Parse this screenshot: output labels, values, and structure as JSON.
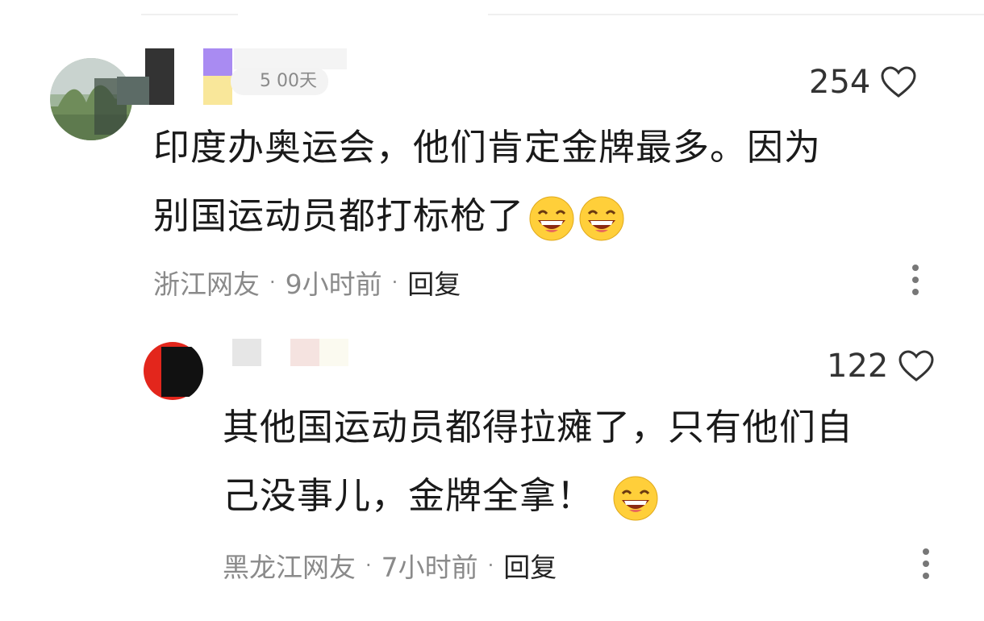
{
  "comments": [
    {
      "badge": "5 00天",
      "likes": "254",
      "text_line1": "印度办奥运会，他们肯定金牌最多。因为",
      "text_line2": "别国运动员都打标枪了",
      "location": "浙江网友",
      "time": "9小时前",
      "reply_label": "回复",
      "icons": [
        "heart-icon",
        "grinning-emoji",
        "more-vertical-icon"
      ]
    },
    {
      "likes": "122",
      "text_line1": "其他国运动员都得拉瘫了，只有他们自",
      "text_line2": "己没事儿，金牌全拿！",
      "location": "黑龙江网友",
      "time": "7小时前",
      "reply_label": "回复",
      "icons": [
        "heart-icon",
        "grinning-emoji",
        "more-vertical-icon"
      ]
    }
  ],
  "separator_dot": "·"
}
